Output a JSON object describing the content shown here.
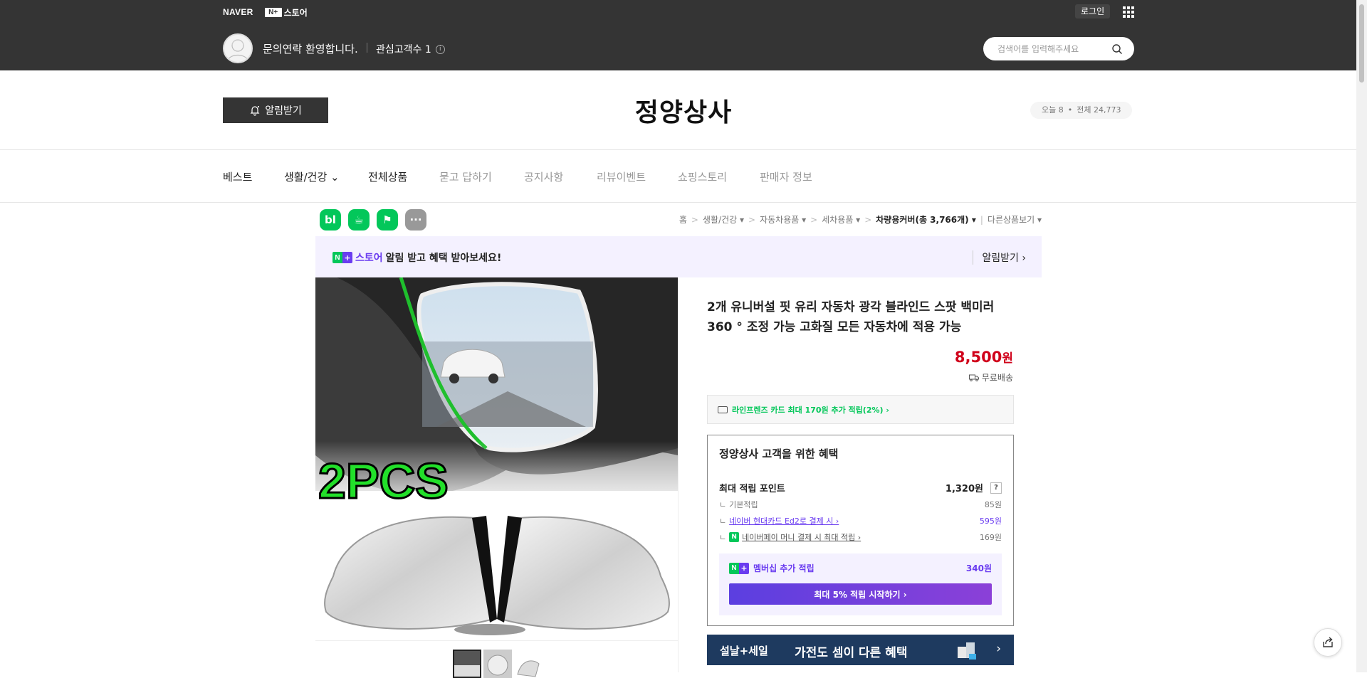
{
  "topbar": {
    "naver": "NAVER",
    "nplus_box": "N+",
    "nplus_label": "스토어",
    "login": "로그인",
    "welcome": "문의연락 환영합니다.",
    "fans": "관심고객수 1",
    "info": "i",
    "search_placeholder": "검색어를 입력해주세요"
  },
  "header": {
    "alarm": "알림받기",
    "store_name": "정양상사",
    "today": "오늘 8",
    "total": "전체 24,773"
  },
  "nav": {
    "items": [
      "베스트",
      "생활/건강 ⌄",
      "전체상품",
      "묻고 답하기",
      "공지사항",
      "리뷰이벤트",
      "쇼핑스토리",
      "판매자 정보"
    ]
  },
  "share": {
    "blog": "bl",
    "cafe": "☕",
    "bookmark": "⚑",
    "more": "···"
  },
  "breadcrumb": {
    "items": [
      "홈",
      "생활/건강 ▾",
      "자동차용품 ▾",
      "세차용품 ▾",
      "차량용커버(총 3,766개) ▾",
      "다른상품보기 ▾"
    ],
    "sep": ">"
  },
  "promo": {
    "n": "N",
    "plus": "+",
    "store": "스토어",
    "text": "알림 받고 혜택 받아보세요!",
    "right": "알림받기 ›"
  },
  "product": {
    "name": "2개 유니버설 핏 유리 자동차 광각 블라인드 스팟 백미러 360 ° 조정 가능 고화질 모든 자동차에 적용 가능",
    "image_text": "2PCS",
    "price": "8,500",
    "won": "원",
    "shipping": "무료배송",
    "card_offer": "라인프렌즈 카드 최대 170원 추가 적립(2%) ›"
  },
  "benefit": {
    "title": "정양상사 고객을 위한 혜택",
    "max_label": "최대 적립 포인트",
    "max_val": "1,320원",
    "q": "?",
    "tree": "ㄴ",
    "base_label": "기본적립",
    "base_val": "85원",
    "card_label": "네이버 현대카드 Ed2로 결제 시 ›",
    "card_val": "595원",
    "npay_badge": "N",
    "npay_label": "네이버페이 머니 결제 시 최대 적립 ›",
    "npay_val": "169원",
    "membership_label": "멤버십 추가 적립",
    "membership_val": "340원",
    "membership_btn": "최대 5% 적립 시작하기 ›"
  },
  "sale": {
    "t1": "설날+세일",
    "t2": "가전도 셈이 다른 혜택",
    "arrow": "›"
  },
  "colors": {
    "topbar": "#343434",
    "naver_green": "#03c75a",
    "price_red": "#d0021b",
    "membership_purple": "#6a3cf0"
  }
}
